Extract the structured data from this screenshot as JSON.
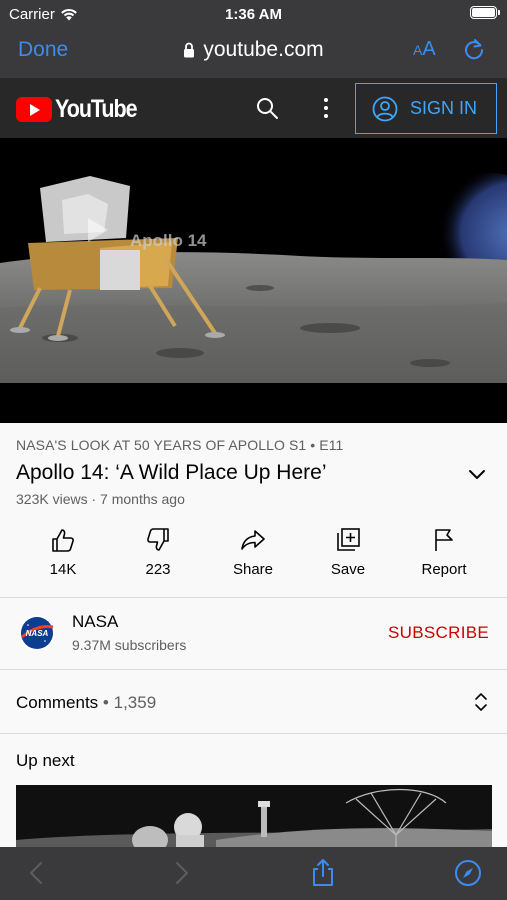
{
  "status_bar": {
    "carrier": "Carrier",
    "time": "1:36 AM"
  },
  "browser": {
    "done_label": "Done",
    "url": "youtube.com",
    "text_size_label_small": "A",
    "text_size_label_large": "A"
  },
  "youtube_header": {
    "logo_text": "YouTube",
    "sign_in_label": "SIGN IN"
  },
  "video": {
    "overlay_text": "Apollo 14",
    "series_label": "NASA'S LOOK AT 50 YEARS OF APOLLO  S1 • E11",
    "title": "Apollo 14: ‘A Wild Place Up Here’",
    "meta": "323K views · 7 months ago"
  },
  "actions": [
    {
      "label": "14K",
      "icon": "thumbs-up-icon"
    },
    {
      "label": "223",
      "icon": "thumbs-down-icon"
    },
    {
      "label": "Share",
      "icon": "share-icon"
    },
    {
      "label": "Save",
      "icon": "save-icon"
    },
    {
      "label": "Report",
      "icon": "flag-icon"
    }
  ],
  "channel": {
    "name": "NASA",
    "subscribers": "9.37M subscribers",
    "subscribe_label": "SUBSCRIBE",
    "avatar_text": "NASA"
  },
  "comments": {
    "label": "Comments",
    "separator": "•",
    "count": "1,359"
  },
  "up_next": {
    "label": "Up next"
  },
  "colors": {
    "youtube_red": "#ff0000",
    "subscribe_red": "#cc0000",
    "ios_blue": "#3b8cf1",
    "signin_blue": "#3ea6ff"
  }
}
